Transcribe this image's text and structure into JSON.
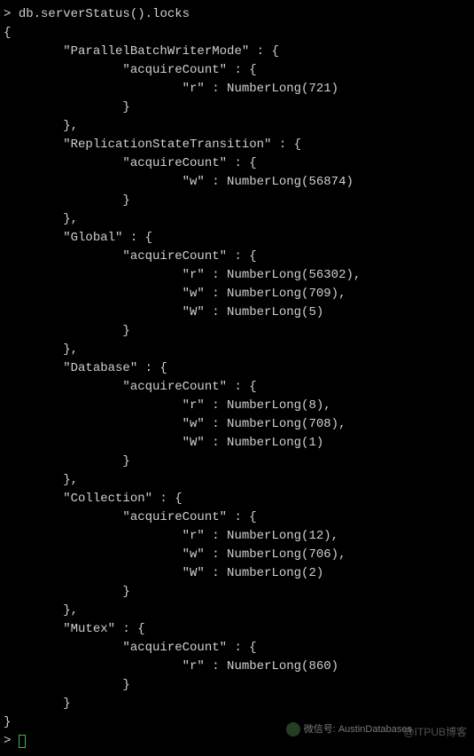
{
  "prompt": ">",
  "command": "db.serverStatus().locks",
  "output_open": "{",
  "locks": {
    "ParallelBatchWriterMode": {
      "acquireCount": {
        "r": "NumberLong(721)"
      }
    },
    "ReplicationStateTransition": {
      "acquireCount": {
        "w": "NumberLong(56874)"
      }
    },
    "Global": {
      "acquireCount": {
        "r": "NumberLong(56302)",
        "w": "NumberLong(709)",
        "W": "NumberLong(5)"
      }
    },
    "Database": {
      "acquireCount": {
        "r": "NumberLong(8)",
        "w": "NumberLong(708)",
        "W": "NumberLong(1)"
      }
    },
    "Collection": {
      "acquireCount": {
        "r": "NumberLong(12)",
        "w": "NumberLong(706)",
        "W": "NumberLong(2)"
      }
    },
    "Mutex": {
      "acquireCount": {
        "r": "NumberLong(860)"
      }
    }
  },
  "output_close": "}",
  "wechat_label": "微信号: AustinDatabases",
  "watermark": "@ITPUB博客"
}
